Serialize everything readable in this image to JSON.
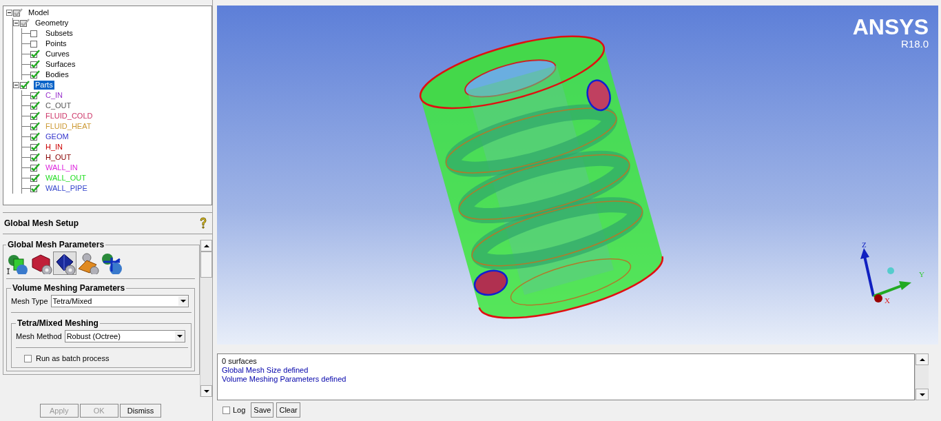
{
  "tree": [
    {
      "label": "Model",
      "checked": true,
      "greyed": true,
      "expanded": true,
      "selected": false,
      "children": [
        {
          "label": "Geometry",
          "checked": true,
          "greyed": true,
          "expanded": true,
          "selected": false,
          "children": [
            {
              "label": "Subsets",
              "checked": false,
              "selected": false
            },
            {
              "label": "Points",
              "checked": false,
              "selected": false
            },
            {
              "label": "Curves",
              "checked": true,
              "selected": false
            },
            {
              "label": "Surfaces",
              "checked": true,
              "selected": false
            },
            {
              "label": "Bodies",
              "checked": true,
              "selected": false
            }
          ]
        },
        {
          "label": "Parts",
          "checked": true,
          "expanded": true,
          "selected": true,
          "children": [
            {
              "label": "C_IN",
              "checked": true,
              "selected": false,
              "color": "#9933cc"
            },
            {
              "label": "C_OUT",
              "checked": true,
              "selected": false,
              "color": "#555555"
            },
            {
              "label": "FLUID_COLD",
              "checked": true,
              "selected": false,
              "color": "#cc3366"
            },
            {
              "label": "FLUID_HEAT",
              "checked": true,
              "selected": false,
              "color": "#cc9933"
            },
            {
              "label": "GEOM",
              "checked": true,
              "selected": false,
              "color": "#3333cc"
            },
            {
              "label": "H_IN",
              "checked": true,
              "selected": false,
              "color": "#cc0000"
            },
            {
              "label": "H_OUT",
              "checked": true,
              "selected": false,
              "color": "#880000"
            },
            {
              "label": "WALL_IN",
              "checked": true,
              "selected": false,
              "color": "#dd22dd"
            },
            {
              "label": "WALL_OUT",
              "checked": true,
              "selected": false,
              "color": "#22dd22"
            },
            {
              "label": "WALL_PIPE",
              "checked": true,
              "selected": false,
              "color": "#3344cc"
            }
          ]
        }
      ]
    }
  ],
  "setup": {
    "title": "Global Mesh Setup",
    "group": "Global Mesh Parameters",
    "tools": [
      {
        "kind": "size",
        "selected": false
      },
      {
        "kind": "shell",
        "selected": false
      },
      {
        "kind": "volume",
        "selected": true
      },
      {
        "kind": "prism",
        "selected": false
      },
      {
        "kind": "periodic",
        "selected": false
      }
    ],
    "volume_group": "Volume Meshing Parameters",
    "mesh_type": {
      "label": "Mesh Type",
      "value": "Tetra/Mixed"
    },
    "sub_group": "Tetra/Mixed Meshing",
    "mesh_method": {
      "label": "Mesh Method",
      "value": "Robust (Octree)"
    },
    "options": [
      {
        "label": "Run as batch process",
        "checked": false
      }
    ],
    "buttons": [
      {
        "label": "Apply",
        "disabled": true
      },
      {
        "label": "OK",
        "disabled": true
      },
      {
        "label": "Dismiss",
        "disabled": false
      }
    ]
  },
  "viewport": {
    "logo": "ANSYS",
    "version": "R18.0",
    "axes": [
      {
        "label": "Z"
      },
      {
        "label": "Y"
      },
      {
        "label": "X"
      }
    ]
  },
  "messages": [
    {
      "text": "0 surfaces",
      "kind": "plain"
    },
    {
      "text": "Global Mesh Size defined",
      "kind": "notice"
    },
    {
      "text": "Volume Meshing Parameters defined",
      "kind": "notice"
    }
  ],
  "log_bar": {
    "log": {
      "label": "Log",
      "checked": false
    },
    "buttons": [
      "Save",
      "Clear"
    ]
  }
}
